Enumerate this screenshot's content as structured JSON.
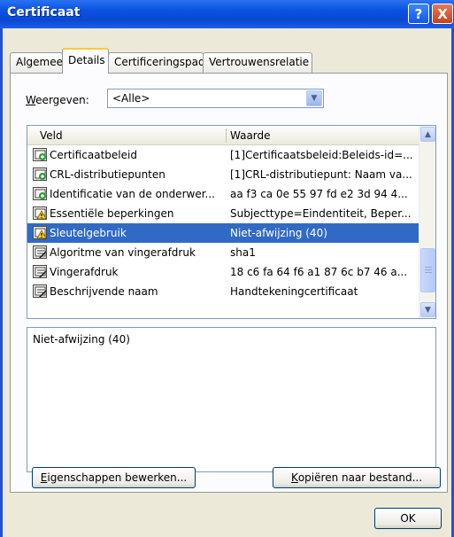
{
  "window": {
    "title": "Certificaat",
    "help_glyph": "?",
    "close_glyph": "X"
  },
  "tabs": [
    {
      "label": "Algemeen",
      "active": false
    },
    {
      "label": "Details",
      "active": true
    },
    {
      "label": "Certificeringspad",
      "active": false
    },
    {
      "label": "Vertrouwensrelatie",
      "active": false
    }
  ],
  "show": {
    "label_ul": "W",
    "label_rest": "eergeven:",
    "selected": "<Alle>"
  },
  "list": {
    "columns": [
      "Veld",
      "Waarde"
    ],
    "rows": [
      {
        "field": "Certificaatbeleid",
        "value": "[1]Certificaatsbeleid:Beleids-id=...",
        "icon": "extension-icon",
        "selected": false
      },
      {
        "field": "CRL-distributiepunten",
        "value": "[1]CRL-distributiepunt: Naam va...",
        "icon": "extension-icon",
        "selected": false
      },
      {
        "field": "Identificatie van de onderwer...",
        "value": "aa f3 ca 0e 55 97 fd e2 3d 94 4...",
        "icon": "extension-icon",
        "selected": false
      },
      {
        "field": "Essentiële beperkingen",
        "value": "Subjecttype=Eindentiteit, Beper...",
        "icon": "critical-extension-icon",
        "selected": false
      },
      {
        "field": "Sleutelgebruik",
        "value": "Niet-afwijzing (40)",
        "icon": "critical-extension-icon",
        "selected": true
      },
      {
        "field": "Algoritme van vingerafdruk",
        "value": "sha1",
        "icon": "property-icon",
        "selected": false
      },
      {
        "field": "Vingerafdruk",
        "value": "18 c6 fa 64 f6 a1 87 6c b7 46 a...",
        "icon": "property-icon",
        "selected": false
      },
      {
        "field": "Beschrijvende naam",
        "value": "Handtekeningcertificaat",
        "icon": "property-icon",
        "selected": false
      }
    ]
  },
  "detail": {
    "text": "Niet-afwijzing (40)"
  },
  "buttons": {
    "edit_ul": "E",
    "edit_rest": "igenschappen bewerken...",
    "copy_ul": "K",
    "copy_rest": "opiëren naar bestand...",
    "ok": "OK"
  }
}
